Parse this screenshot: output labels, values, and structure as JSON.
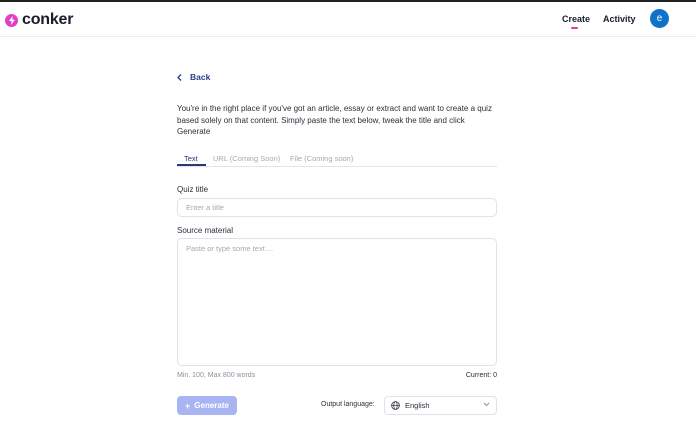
{
  "header": {
    "brand": "conker",
    "nav": [
      {
        "label": "Create"
      },
      {
        "label": "Activity"
      }
    ],
    "avatar_initial": "e",
    "brand_color": "#e040c8",
    "avatar_color": "#0f74c8",
    "logo_icon": "lightning-icon"
  },
  "main": {
    "back_label": "Back",
    "intro": "You're in the right place if you've got an article, essay or extract and want to create a quiz based solely on that content. Simply paste the text below, tweak the title and click Generate",
    "tabs": [
      {
        "label": "Text",
        "active": true
      },
      {
        "label": "URL (Coming Soon)",
        "active": false
      },
      {
        "label": "File (Coming soon)",
        "active": false
      }
    ],
    "quiz_title": {
      "label": "Quiz title",
      "placeholder": "Enter a title",
      "value": ""
    },
    "source": {
      "label": "Source material",
      "placeholder": "Paste or type some text ...",
      "value": ""
    },
    "word_hint": "Min. 100, Max 800 words",
    "counter": "Current: 0",
    "generate_label": "Generate",
    "generate_color": "#a9b4f2",
    "output_language": {
      "label": "Output language:",
      "selected": "English"
    }
  }
}
